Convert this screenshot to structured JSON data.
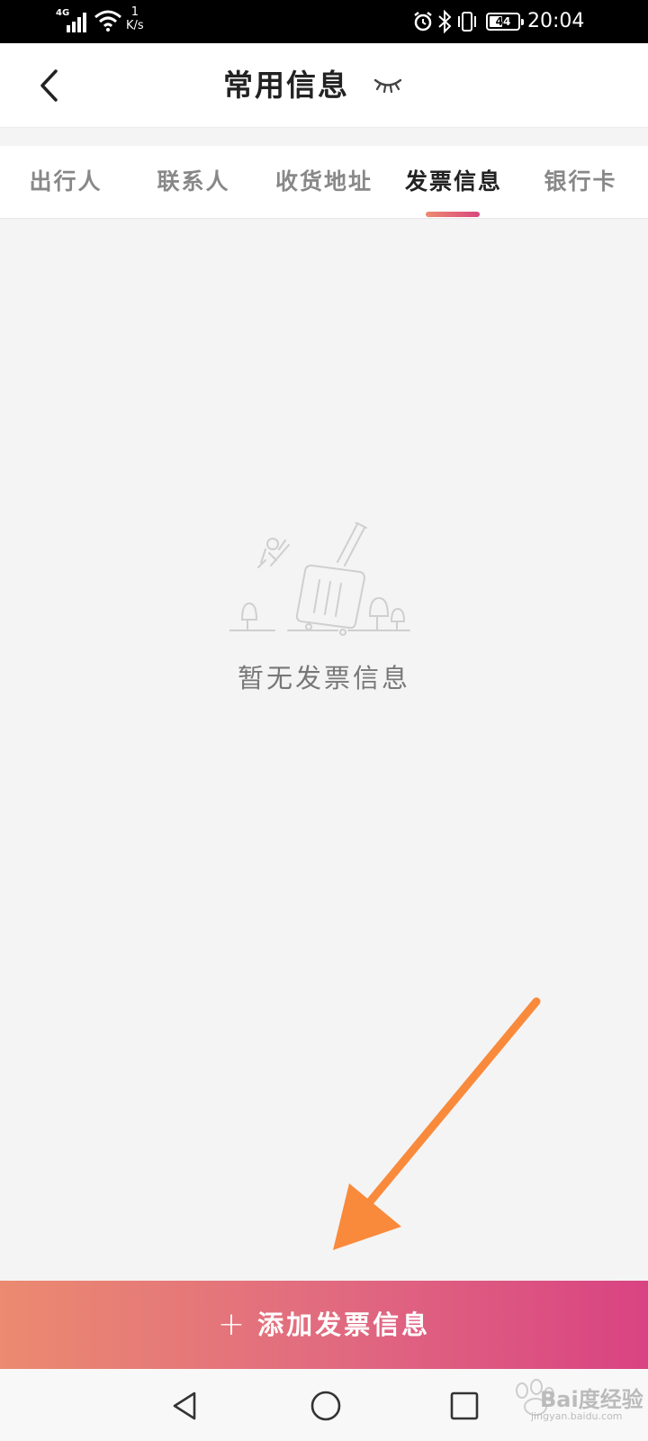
{
  "status_bar": {
    "network": "4G",
    "speed_value": "1",
    "speed_unit": "K/s",
    "battery": "44",
    "time": "20:04"
  },
  "header": {
    "title": "常用信息",
    "back_icon": "chevron-left-icon",
    "extra_icon": "closed-eye-icon"
  },
  "tabs": [
    {
      "label": "出行人",
      "active": false
    },
    {
      "label": "联系人",
      "active": false
    },
    {
      "label": "收货地址",
      "active": false
    },
    {
      "label": "发票信息",
      "active": true
    },
    {
      "label": "银行卡",
      "active": false
    }
  ],
  "empty_state": {
    "illustration": "luggage-illustration",
    "message": "暂无发票信息"
  },
  "add_button": {
    "icon": "plus-icon",
    "label": "添加发票信息"
  },
  "nav_bar": {
    "back_icon": "triangle-back-icon",
    "home_icon": "circle-home-icon",
    "recent_icon": "square-recents-icon"
  },
  "watermark": {
    "text": "Bai度经验",
    "url": "jingyan.baidu.com"
  },
  "colors": {
    "accent_start": "#eb8a70",
    "accent_end": "#d94382",
    "annotation_arrow": "#f98a3c"
  }
}
